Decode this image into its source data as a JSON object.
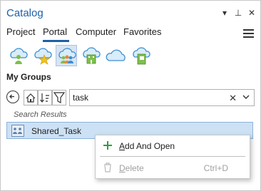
{
  "window": {
    "title": "Catalog",
    "controls": {
      "menu": "▾",
      "pin": "⊥",
      "close": "✕"
    }
  },
  "tabs": [
    {
      "label": "Project"
    },
    {
      "label": "Portal",
      "active": true
    },
    {
      "label": "Computer"
    },
    {
      "label": "Favorites"
    }
  ],
  "sources": [
    {
      "icon": "my-content-cloud-icon"
    },
    {
      "icon": "favorites-cloud-icon"
    },
    {
      "icon": "my-groups-cloud-icon",
      "selected": true
    },
    {
      "icon": "organization-cloud-icon"
    },
    {
      "icon": "arcgis-online-cloud-icon"
    },
    {
      "icon": "living-atlas-cloud-icon"
    }
  ],
  "section": {
    "label": "My Groups"
  },
  "search": {
    "value": "task",
    "clear": "✕",
    "dropdown": "⌄"
  },
  "results": {
    "label": "Search Results",
    "items": [
      {
        "label": "Shared_Task",
        "selected": true
      }
    ]
  },
  "context_menu": {
    "items": [
      {
        "label_pre": "",
        "label_acc": "A",
        "label_post": "dd And Open",
        "shortcut": "",
        "enabled": true
      },
      {
        "label_pre": "",
        "label_acc": "D",
        "label_post": "elete",
        "shortcut": "Ctrl+D",
        "enabled": false
      }
    ]
  },
  "colors": {
    "accent": "#1f5fa8",
    "selection": "#cde1f5",
    "add": "#2e9e3e"
  }
}
